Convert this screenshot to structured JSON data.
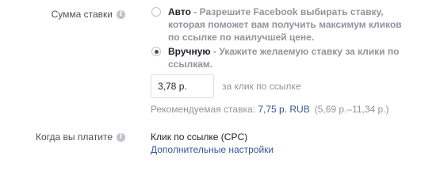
{
  "bid_amount": {
    "label": "Сумма ставки",
    "info_icon": "info-icon",
    "options": [
      {
        "name": "Авто",
        "separator": " - ",
        "description": "Разрешите Facebook выбирать ставку, которая поможет вам получить максимум кликов по ссылке по наилучшей цене.",
        "selected": false
      },
      {
        "name": "Вручную",
        "separator": " - ",
        "description": "Укажите желаемую ставку за клики по ссылкам.",
        "selected": true
      }
    ],
    "input_value": "3,78 р.",
    "input_suffix": "за клик по ссылке",
    "recommended_label": "Рекомендуемая ставка: ",
    "recommended_value": "7,75 р. RUB",
    "recommended_range": "(5,69 р.–11,34 р.)"
  },
  "when_you_pay": {
    "label": "Когда вы платите",
    "info_icon": "info-icon",
    "value": "Клик по ссылке (CPC)",
    "advanced_link": "Дополнительные настройки"
  }
}
